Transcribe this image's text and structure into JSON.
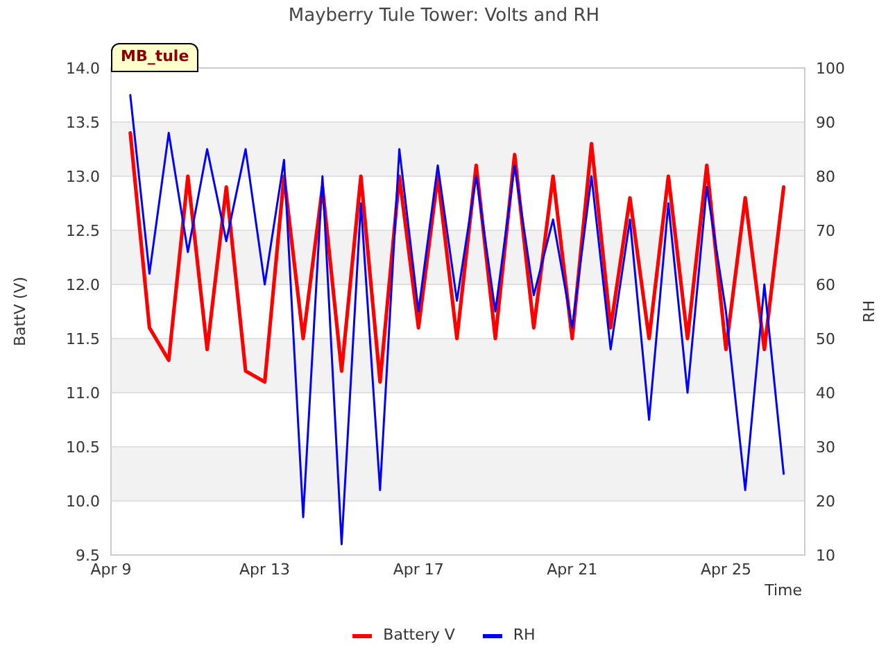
{
  "title": "Mayberry Tule Tower: Volts and RH",
  "badge": "MB_tule",
  "battv_plot": {
    "chart_data": {
      "type": "line",
      "grid": true,
      "xlabel": "Time",
      "ylabel": "BattV (V)",
      "categories": [
        "Apr 9",
        null,
        null,
        null,
        null,
        null,
        null,
        null,
        "Apr 13",
        null,
        null,
        null,
        null,
        null,
        null,
        null,
        "Apr 17",
        null,
        null,
        null,
        null,
        null,
        null,
        null,
        "Apr 21",
        null,
        null,
        null,
        null,
        null,
        null,
        null,
        "Apr 25",
        null,
        null,
        null
      ],
      "series": [
        {
          "name": "Battery V",
          "color": "#ff0000",
          "values": [
            null,
            13.4,
            11.6,
            11.3,
            13.0,
            11.4,
            12.9,
            11.2,
            11.1,
            13.0,
            11.5,
            12.9,
            11.2,
            13.0,
            11.1,
            13.0,
            11.6,
            13.0,
            11.5,
            13.1,
            11.5,
            13.2,
            11.6,
            13.0,
            11.5,
            13.3,
            11.6,
            12.8,
            11.5,
            13.0,
            11.5,
            13.1,
            11.4,
            12.8,
            11.4,
            12.9
          ]
        }
      ],
      "ylim": [
        9.5,
        14.0
      ],
      "yticks": [
        {
          "value": 9.5,
          "label": "9.5"
        },
        {
          "value": 10,
          "label": "10.0"
        },
        {
          "value": 10.5,
          "label": "10.5"
        },
        {
          "value": 11,
          "label": "11.0"
        },
        {
          "value": 11.5,
          "label": "11.5"
        },
        {
          "value": 12,
          "label": "12.0"
        },
        {
          "value": 12.5,
          "label": "12.5"
        },
        {
          "value": 13,
          "label": "13.0"
        },
        {
          "value": 13.5,
          "label": "13.5"
        },
        {
          "value": 14,
          "label": "14.0"
        }
      ]
    }
  },
  "rh_plot": {
    "chart_data": {
      "type": "line",
      "ylabel": "RH",
      "categories": [
        null,
        null,
        null,
        null,
        null,
        null,
        null,
        null,
        null,
        null,
        null,
        null,
        null,
        null,
        null,
        null,
        null,
        null,
        null,
        null,
        null,
        null,
        null,
        null,
        null,
        null,
        null,
        null,
        null,
        null,
        null,
        null,
        null,
        null,
        null,
        null
      ],
      "series": [
        {
          "name": "RH",
          "color": "#0000ff",
          "values": [
            null,
            95,
            62,
            88,
            66,
            85,
            68,
            85,
            60,
            83,
            17,
            80,
            12,
            75,
            22,
            85,
            55,
            82,
            57,
            80,
            55,
            82,
            58,
            72,
            52,
            80,
            48,
            72,
            35,
            75,
            40,
            78,
            55,
            22,
            60,
            25
          ]
        }
      ],
      "ylim": [
        10,
        100
      ],
      "yticks": [
        10,
        20,
        30,
        40,
        50,
        60,
        70,
        80,
        90,
        100
      ]
    }
  }
}
